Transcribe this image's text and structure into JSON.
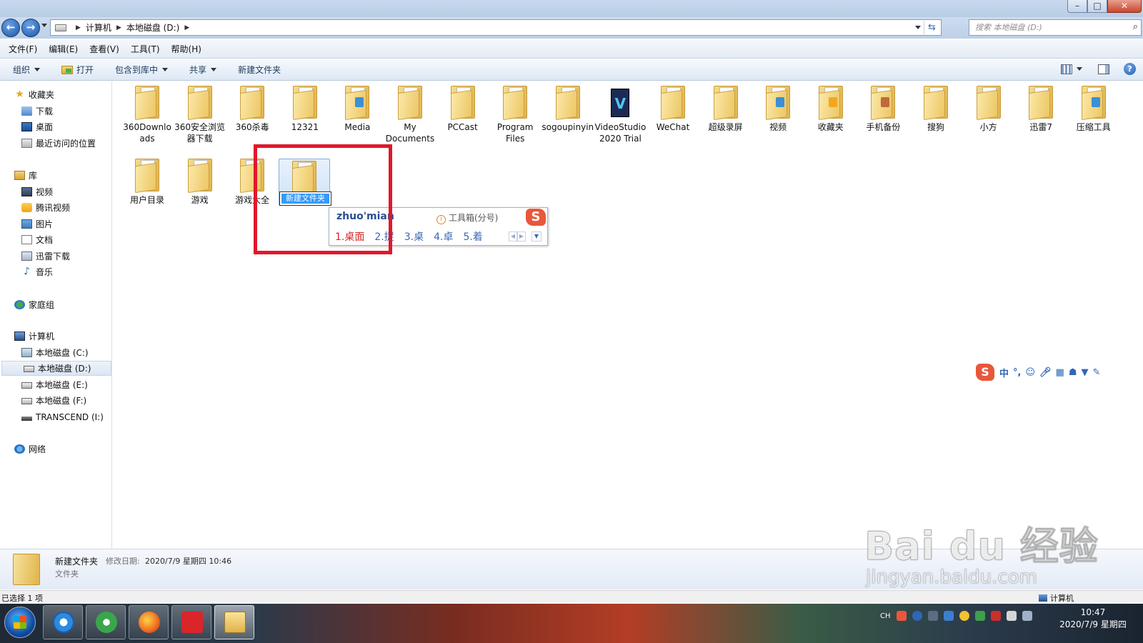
{
  "window": {
    "min_label": "–",
    "max_label": "□",
    "close_label": "✕"
  },
  "address_bar": {
    "crumbs": [
      "计算机",
      "本地磁盘 (D:)"
    ],
    "search_placeholder": "搜索 本地磁盘 (D:)"
  },
  "menu": [
    "文件(F)",
    "编辑(E)",
    "查看(V)",
    "工具(T)",
    "帮助(H)"
  ],
  "toolbar": {
    "organize": "组织",
    "open": "打开",
    "include_library": "包含到库中",
    "share": "共享",
    "new_folder": "新建文件夹",
    "help_label": "?"
  },
  "nav_pane": {
    "favorites": {
      "label": "收藏夹",
      "items": [
        "下载",
        "桌面",
        "最近访问的位置"
      ]
    },
    "libraries": {
      "label": "库",
      "items": [
        "视频",
        "腾讯视频",
        "图片",
        "文档",
        "迅雷下载",
        "音乐"
      ]
    },
    "homegroup": "家庭组",
    "computer": {
      "label": "计算机",
      "items": [
        "本地磁盘 (C:)",
        "本地磁盘 (D:)",
        "本地磁盘 (E:)",
        "本地磁盘 (F:)",
        "TRANSCEND (I:)"
      ]
    },
    "network": "网络",
    "selected": "本地磁盘 (D:)"
  },
  "files_row1": [
    {
      "name": "360Downloads",
      "icon": "folder"
    },
    {
      "name": "360安全浏览器下载",
      "icon": "folder"
    },
    {
      "name": "360杀毒",
      "icon": "folder"
    },
    {
      "name": "12321",
      "icon": "folder"
    },
    {
      "name": "Media",
      "icon": "folder-media"
    },
    {
      "name": "My Documents",
      "icon": "folder"
    },
    {
      "name": "PCCast",
      "icon": "folder"
    },
    {
      "name": "Program Files",
      "icon": "folder"
    },
    {
      "name": "sogoupinyin",
      "icon": "folder"
    },
    {
      "name": "VideoStudio 2020 Trial",
      "icon": "videostudio"
    },
    {
      "name": "WeChat",
      "icon": "folder"
    },
    {
      "name": "超级录屏",
      "icon": "folder"
    },
    {
      "name": "视频",
      "icon": "folder-media"
    },
    {
      "name": "收藏夹",
      "icon": "folder-star"
    },
    {
      "name": "手机备份",
      "icon": "folder-people"
    },
    {
      "name": "搜狗",
      "icon": "folder"
    },
    {
      "name": "小方",
      "icon": "folder"
    },
    {
      "name": "迅雷7",
      "icon": "folder"
    },
    {
      "name": "压缩工具",
      "icon": "folder-media"
    }
  ],
  "files_row2": [
    {
      "name": "用户目录",
      "icon": "folder"
    },
    {
      "name": "游戏",
      "icon": "folder"
    },
    {
      "name": "游戏大全",
      "icon": "folder"
    }
  ],
  "renaming": {
    "value": "新建文件夹"
  },
  "ime": {
    "pinyin": "zhuo'mian",
    "toolbox": "工具箱(分号)",
    "candidates": [
      "1.桌面",
      "2.捉",
      "3.桌",
      "4.卓",
      "5.着"
    ],
    "logo": "S"
  },
  "sogou_bar": {
    "logo": "S",
    "mode": "中",
    "punct": "°,",
    "icons": [
      "emoji-icon",
      "mic-icon",
      "keyboard-icon",
      "user-icon",
      "skin-icon",
      "tool-icon"
    ]
  },
  "details": {
    "name": "新建文件夹",
    "modified_label": "修改日期:",
    "modified": "2020/7/9 星期四 10:46",
    "type": "文件夹"
  },
  "status": {
    "selected": "已选择 1 项",
    "computer": "计算机"
  },
  "taskbar": {
    "lang": "CH",
    "time": "10:47",
    "date": "2020/7/9 星期四"
  },
  "watermark": {
    "line1": "Bai du 经验",
    "line2": "jingyan.baidu.com"
  },
  "colors": {
    "highlight": "#e0182b",
    "selection": "#3399ff"
  }
}
